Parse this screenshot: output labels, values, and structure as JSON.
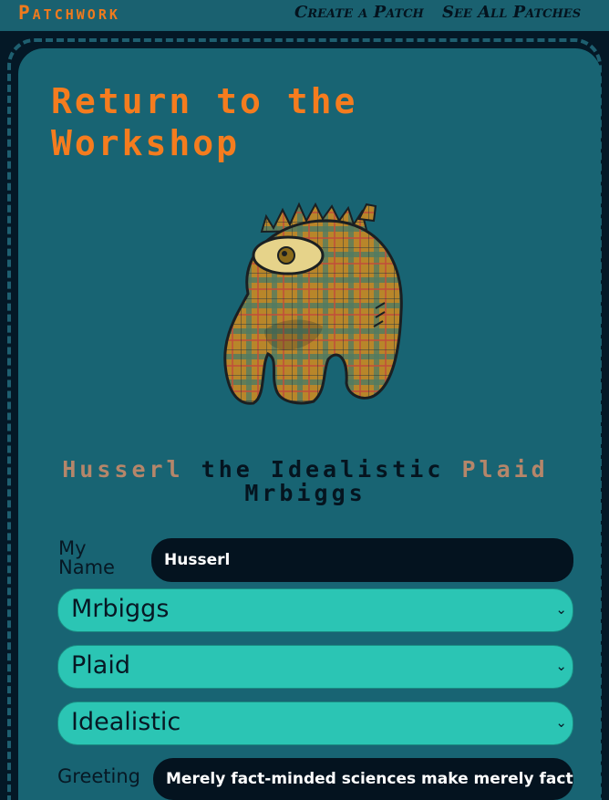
{
  "nav": {
    "brand": "Patchwork",
    "create_link": "Create a Patch",
    "see_all_link": "See All Patches"
  },
  "page": {
    "title": "Return to the Workshop"
  },
  "creature": {
    "name": "Husserl",
    "mid": "the",
    "trait": "Idealistic",
    "pattern": "Plaid",
    "species": "Mrbiggs"
  },
  "form": {
    "name_label": "My Name",
    "name_value": "Husserl",
    "species_value": "Mrbiggs",
    "pattern_value": "Plaid",
    "trait_value": "Idealistic",
    "greeting_label": "Greeting",
    "greeting_value": "Merely fact-minded sciences make merely fact-n"
  },
  "colors": {
    "accent_orange": "#f57c1e",
    "card_teal": "#186473",
    "select_teal": "#2bc5b4",
    "dark_navy": "#041826"
  }
}
